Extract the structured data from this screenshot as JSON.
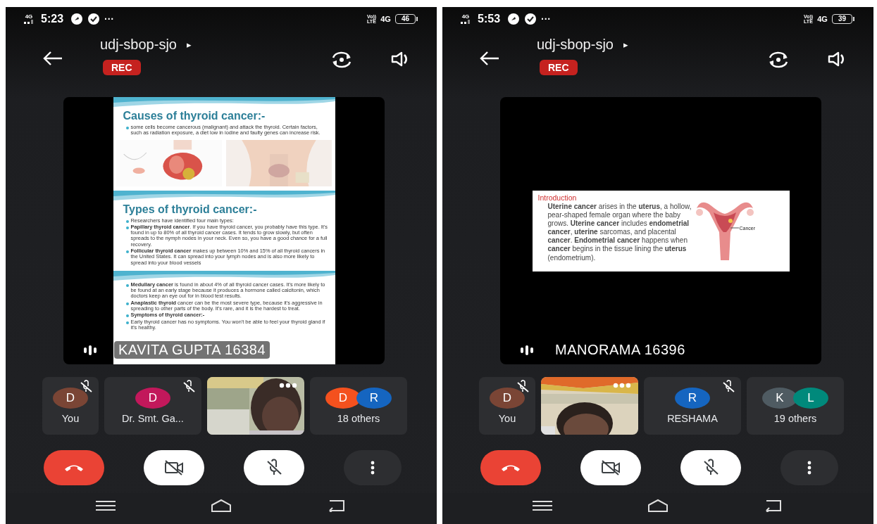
{
  "phones": [
    {
      "status_bar": {
        "network": "4G",
        "time": "5:23",
        "more": "···",
        "volte": [
          "Vo))",
          "LTE"
        ],
        "network_type": "4G",
        "battery": "46"
      },
      "meeting": {
        "code": "udj-sbop-sjo",
        "caret": "▸",
        "rec": "REC"
      },
      "presentation": {
        "speaker": "KAVITA GUPTA 16384",
        "slide": {
          "kind": "sections",
          "sections": [
            {
              "title": "Causes of thyroid cancer:-",
              "items": [
                "some cells become cancerous (malignant) and attack the thyroid. Certain factors, such as radiation exposure, a diet low in iodine and faulty genes can increase risk."
              ],
              "figures": [
                {
                  "kind": "picture"
                },
                {
                  "kind": "picture"
                }
              ]
            },
            {
              "title": "Types of thyroid cancer:-",
              "items": [
                "Researchers have identified four main types:",
                "**Papillary thyroid cancer**. If you have thyroid cancer, you probably have this type. It's found in up to 80% of all thyroid cancer cases. It tends to grow slowly, but often spreads to the nymph nodes in your neck. Even so, you have a good chance for a full recovery.",
                "**Follicular thyroid cancer** makes up between 10% and 15% of all thyroid cancers in the United States. It can spread into your lymph nodes and is also more likely to spread into your blood vessels"
              ]
            },
            {
              "items": [
                "**Medullary cancer** is found in about 4% of all thyroid cancer cases. It's more likely to be found at an early stage because it produces a hormone called calcitonin, which doctors keep an eye out for in blood test results.",
                "**Anaplastic thyroid** cancer can be the most severe type, because it's aggressive in spreading to other parts of the body. It's rare, and it is the hardest to treat.",
                "**Symptoms of thyroid cancer:-**",
                "Early thyroid cancer has no symptoms. You won't be able to feel your thyroid gland if it's healthy."
              ]
            }
          ]
        }
      },
      "participants": [
        {
          "kind": "avatar",
          "initial": "D",
          "color": "#7a4535",
          "name": "You",
          "muted": true
        },
        {
          "kind": "avatar",
          "initial": "D",
          "color": "#c2185b",
          "name": "Dr. Smt. Ga...",
          "muted": true
        },
        {
          "kind": "video"
        },
        {
          "kind": "group",
          "people": [
            {
              "initial": "D",
              "color": "#f4511e"
            },
            {
              "initial": "R",
              "color": "#1565c0"
            }
          ],
          "name": "18 others"
        }
      ],
      "controls": [
        {
          "kind": "end"
        },
        {
          "kind": "camera",
          "on": false
        },
        {
          "kind": "mic",
          "on": false
        },
        {
          "kind": "more"
        }
      ]
    },
    {
      "status_bar": {
        "network": "4G",
        "time": "5:53",
        "more": "···",
        "volte": [
          "Vo))",
          "LTE"
        ],
        "network_type": "4G",
        "battery": "39"
      },
      "meeting": {
        "code": "udj-sbop-sjo",
        "caret": "▸",
        "rec": "REC"
      },
      "presentation": {
        "speaker": "MANORAMA 16396",
        "slide": {
          "kind": "figure",
          "heading": "Introduction",
          "paragraph": "**Uterine cancer** arises in the **uterus**, a hollow, pear-shaped female organ where the baby grows. **Uterine cancer** includes **endometrial cancer**, **uterine** sarcomas, and placental **cancer**. **Endometrial cancer** happens when **cancer** begins in the tissue lining the **uterus** (endometrium).",
          "figure_label": "Cancer"
        }
      },
      "participants": [
        {
          "kind": "avatar",
          "initial": "D",
          "color": "#7a4535",
          "name": "You",
          "muted": true
        },
        {
          "kind": "video"
        },
        {
          "kind": "avatar",
          "initial": "R",
          "color": "#1565c0",
          "name": "RESHAMA",
          "muted": true
        },
        {
          "kind": "group",
          "people": [
            {
              "initial": "K",
              "color": "#4f5b62"
            },
            {
              "initial": "L",
              "color": "#00897b"
            }
          ],
          "name": "19 others"
        }
      ],
      "controls": [
        {
          "kind": "end"
        },
        {
          "kind": "camera",
          "on": false
        },
        {
          "kind": "mic",
          "on": false
        },
        {
          "kind": "more"
        }
      ]
    }
  ]
}
